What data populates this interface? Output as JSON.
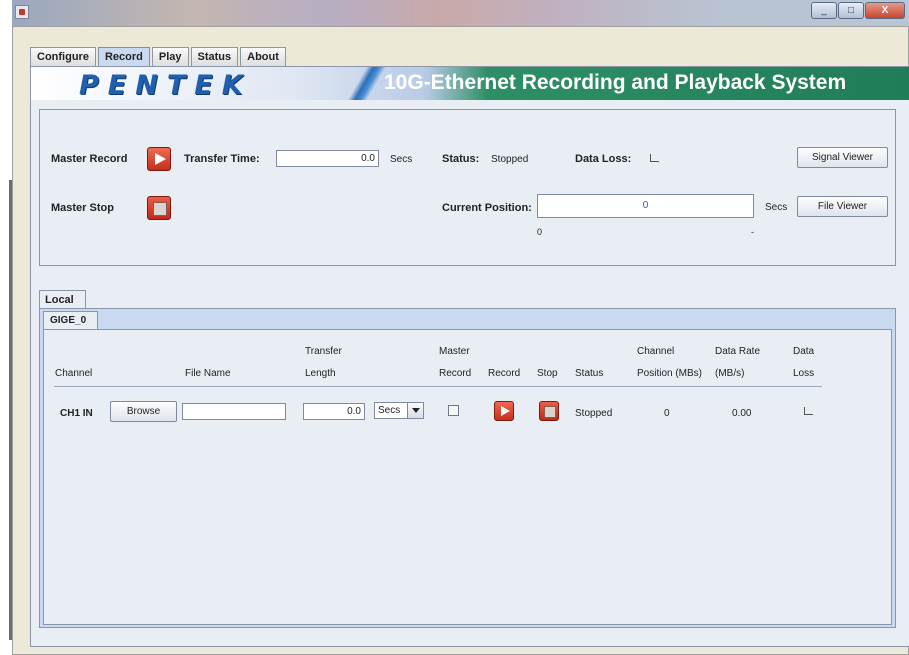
{
  "window": {
    "buttons": [
      "_",
      "□",
      "X"
    ]
  },
  "tabs": [
    "Configure",
    "Record",
    "Play",
    "Status",
    "About"
  ],
  "active_tab": "Record",
  "banner": {
    "logo": "PENTEK",
    "title": "10G-Ethernet Recording and Playback System"
  },
  "master": {
    "record_label": "Master Record",
    "stop_label": "Master Stop",
    "transfer_time_label": "Transfer Time:",
    "transfer_time_value": "0.0",
    "transfer_time_unit": "Secs",
    "status_label": "Status:",
    "status_value": "Stopped",
    "data_loss_label": "Data Loss:",
    "signal_viewer_button": "Signal Viewer",
    "current_position_label": "Current Position:",
    "current_position_value": "0",
    "current_position_unit": "Secs",
    "file_viewer_button": "File Viewer",
    "position_min": "0",
    "position_max": "-"
  },
  "local": {
    "tab_label": "Local",
    "subtab_label": "GIGE_0",
    "columns": {
      "channel": "Channel",
      "file_name": "File Name",
      "transfer_length_1": "Transfer",
      "transfer_length_2": "Length",
      "master_record_1": "Master",
      "master_record_2": "Record",
      "record": "Record",
      "stop": "Stop",
      "status": "Status",
      "channel_position_1": "Channel",
      "channel_position_2": "Position (MBs)",
      "data_rate_1": "Data Rate",
      "data_rate_2": "(MB/s)",
      "data_loss_1": "Data",
      "data_loss_2": "Loss"
    },
    "rows": [
      {
        "channel": "CH1 IN",
        "browse": "Browse",
        "file_name": "",
        "transfer_length": "0.0",
        "unit": "Secs",
        "status": "Stopped",
        "channel_position": "0",
        "data_rate": "0.00"
      }
    ]
  }
}
